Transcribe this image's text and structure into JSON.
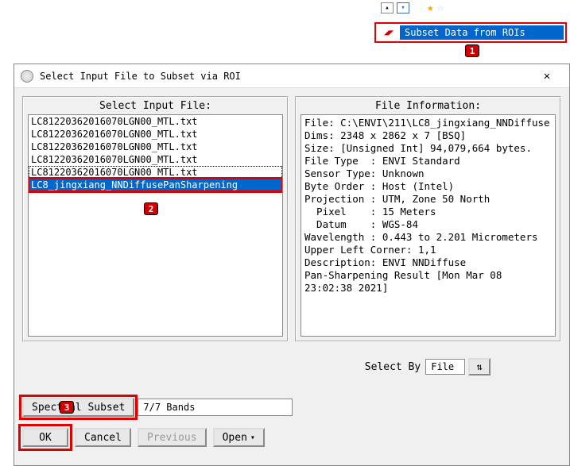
{
  "topPanel": {
    "subsetLabel": "Subset Data from ROIs",
    "callout": "1"
  },
  "dialog": {
    "title": "Select Input File to Subset via ROI",
    "leftPanel": {
      "header": "Select Input File:",
      "items": [
        "LC81220362016070LGN00_MTL.txt",
        "LC81220362016070LGN00_MTL.txt",
        "LC81220362016070LGN00_MTL.txt",
        "LC81220362016070LGN00_MTL.txt",
        "LC81220362016070LGN00_MTL.txt",
        "LC8_jingxiang_NNDiffusePanSharpening"
      ],
      "callout": "2"
    },
    "rightPanel": {
      "header": "File Information:",
      "info": "File: C:\\ENVI\\211\\LC8_jingxiang_NNDiffuse\nDims: 2348 x 2862 x 7 [BSQ]\nSize: [Unsigned Int] 94,079,664 bytes.\nFile Type  : ENVI Standard\nSensor Type: Unknown\nByte Order : Host (Intel)\nProjection : UTM, Zone 50 North\n  Pixel    : 15 Meters\n  Datum    : WGS-84\nWavelength : 0.443 to 2.201 Micrometers\nUpper Left Corner: 1,1\nDescription: ENVI NNDiffuse\nPan-Sharpening Result [Mon Mar 08\n23:02:38 2021]"
    },
    "selectBy": {
      "label": "Select By",
      "value": "File"
    },
    "subset": {
      "buttonLabel": "Spectral Subset",
      "value": "7/7 Bands",
      "callout": "3"
    },
    "buttons": {
      "ok": "OK",
      "cancel": "Cancel",
      "previous": "Previous",
      "open": "Open"
    }
  }
}
